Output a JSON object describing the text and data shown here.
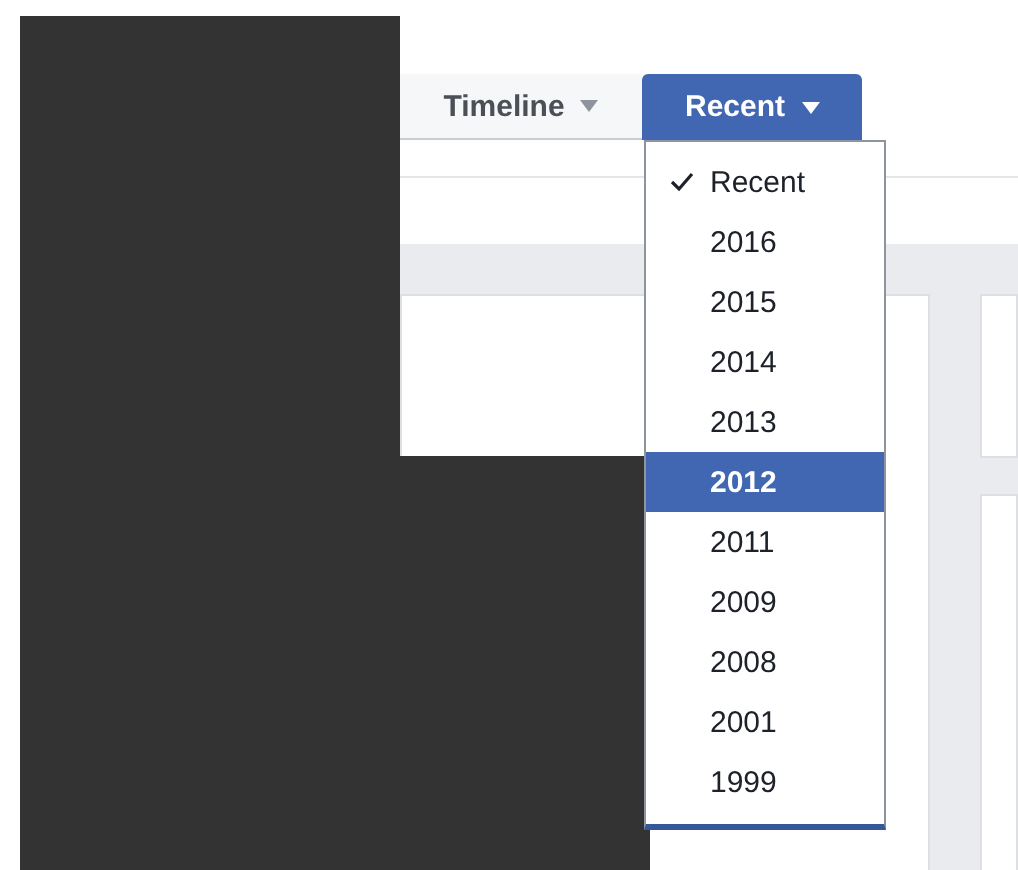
{
  "tabs": [
    {
      "label": "Timeline",
      "selected": false
    },
    {
      "label": "Recent",
      "selected": true
    }
  ],
  "menu": {
    "items": [
      {
        "label": "Recent",
        "checked": true,
        "selected": false
      },
      {
        "label": "2016",
        "checked": false,
        "selected": false
      },
      {
        "label": "2015",
        "checked": false,
        "selected": false
      },
      {
        "label": "2014",
        "checked": false,
        "selected": false
      },
      {
        "label": "2013",
        "checked": false,
        "selected": false
      },
      {
        "label": "2012",
        "checked": false,
        "selected": true
      },
      {
        "label": "2011",
        "checked": false,
        "selected": false
      },
      {
        "label": "2009",
        "checked": false,
        "selected": false
      },
      {
        "label": "2008",
        "checked": false,
        "selected": false
      },
      {
        "label": "2001",
        "checked": false,
        "selected": false
      },
      {
        "label": "1999",
        "checked": false,
        "selected": false
      }
    ]
  }
}
